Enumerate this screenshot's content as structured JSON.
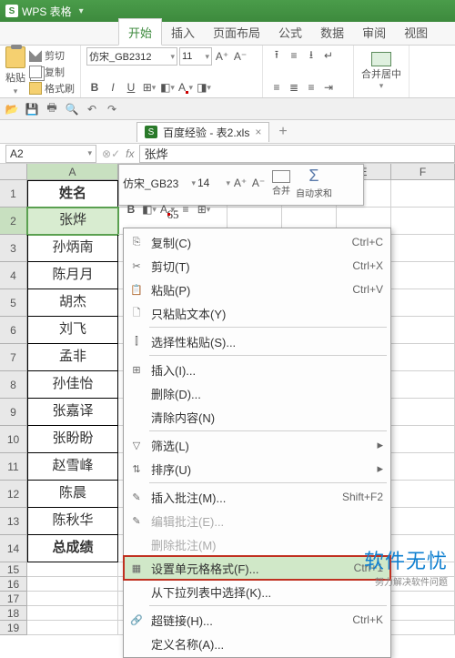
{
  "app": {
    "name": "WPS 表格"
  },
  "ribbonTabs": [
    "开始",
    "插入",
    "页面布局",
    "公式",
    "数据",
    "审阅",
    "视图"
  ],
  "activeTab": "开始",
  "clipboard": {
    "paste": "粘贴",
    "cut": "剪切",
    "copy": "复制",
    "format": "格式刷"
  },
  "font": {
    "family": "仿宋_GB2312",
    "size": "11",
    "bold": "B",
    "italic": "I",
    "underline": "U"
  },
  "merge": {
    "label": "合并居中"
  },
  "sum": {
    "label": "自动求和"
  },
  "workbookTab": {
    "name": "百度经验 - 表2.xls"
  },
  "nameBox": "A2",
  "formulaBar": "张烨",
  "miniToolbar": {
    "font": "仿宋_GB23",
    "size": "14",
    "merge": "合并",
    "sum": "自动求和"
  },
  "columns": [
    "A",
    "B",
    "C",
    "D",
    "E",
    "F"
  ],
  "rowCount": 19,
  "activeRow": 2,
  "cellB2": "65",
  "colAData": [
    "姓名",
    "张烨",
    "孙炳南",
    "陈月月",
    "胡杰",
    "刘飞",
    "孟非",
    "孙佳怡",
    "张嘉译",
    "张盼盼",
    "赵雪峰",
    "陈晨",
    "陈秋华",
    "总成绩"
  ],
  "contextMenu": [
    {
      "icon": "⎘",
      "label": "复制(C)",
      "shortcut": "Ctrl+C"
    },
    {
      "icon": "✂",
      "label": "剪切(T)",
      "shortcut": "Ctrl+X"
    },
    {
      "icon": "📋",
      "label": "粘贴(P)",
      "shortcut": "Ctrl+V"
    },
    {
      "icon": "🗋",
      "label": "只粘贴文本(Y)"
    },
    {
      "sep": true
    },
    {
      "icon": "⫿",
      "label": "选择性粘贴(S)..."
    },
    {
      "sep": true
    },
    {
      "icon": "⊞",
      "label": "插入(I)..."
    },
    {
      "label": "删除(D)..."
    },
    {
      "label": "清除内容(N)"
    },
    {
      "sep": true
    },
    {
      "icon": "▽",
      "label": "筛选(L)",
      "sub": true
    },
    {
      "icon": "⇅",
      "label": "排序(U)",
      "sub": true
    },
    {
      "sep": true
    },
    {
      "icon": "✎",
      "label": "插入批注(M)...",
      "shortcut": "Shift+F2"
    },
    {
      "icon": "✎",
      "label": "编辑批注(E)...",
      "disabled": true
    },
    {
      "label": "删除批注(M)",
      "disabled": true
    },
    {
      "icon": "▦",
      "label": "设置单元格格式(F)...",
      "shortcut": "Ctrl+1",
      "highlight": true
    },
    {
      "label": "从下拉列表中选择(K)..."
    },
    {
      "sep": true
    },
    {
      "icon": "🔗",
      "label": "超链接(H)...",
      "shortcut": "Ctrl+K"
    },
    {
      "label": "定义名称(A)..."
    }
  ],
  "watermark": {
    "big": "软件无忧",
    "small": "努力解决软件问题"
  }
}
